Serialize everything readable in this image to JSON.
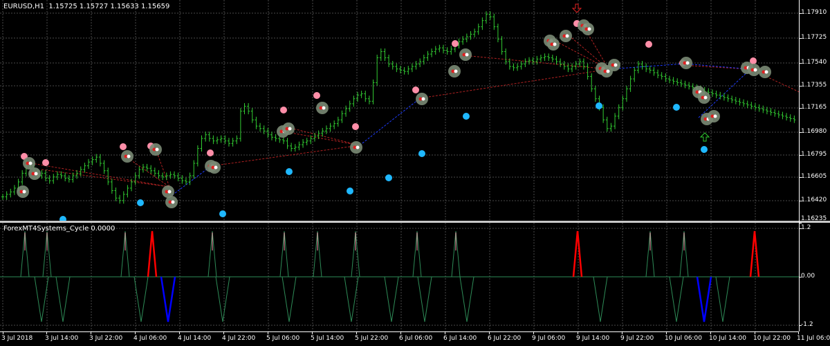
{
  "header": {
    "symbol_tf": "EURUSD,H1",
    "ohlc": "1.15725 1.15727 1.15633 1.15659"
  },
  "indicator": {
    "title": "ForexMT4Systems_Cycle 0.0000",
    "levels": [
      "1.2",
      "0.00",
      "-1.2"
    ]
  },
  "price_axis": {
    "labels": [
      "1.17910",
      "1.17725",
      "1.17540",
      "1.17355",
      "1.17165",
      "1.16980",
      "1.16795",
      "1.16605",
      "1.16420",
      "1.16235"
    ],
    "values": [
      1.1791,
      1.17725,
      1.1754,
      1.17355,
      1.17165,
      1.1698,
      1.16795,
      1.16605,
      1.1642,
      1.16235
    ],
    "range": [
      1.16215,
      1.1801
    ]
  },
  "time_axis": {
    "labels": [
      "3 Jul 2018",
      "3 Jul 14:00",
      "3 Jul 22:00",
      "4 Jul 06:00",
      "4 Jul 14:00",
      "4 Jul 22:00",
      "5 Jul 06:00",
      "5 Jul 14:00",
      "5 Jul 22:00",
      "6 Jul 06:00",
      "6 Jul 14:00",
      "6 Jul 22:00",
      "9 Jul 06:00",
      "9 Jul 14:00",
      "9 Jul 22:00",
      "10 Jul 06:00",
      "10 Jul 14:00",
      "10 Jul 22:00",
      "11 Jul 06:00"
    ]
  },
  "colors": {
    "background": "#000000",
    "grid": "#4a4a4a",
    "bars": "#32cd32",
    "sell_marker": "#ff8ea8",
    "buy_marker": "#1fb8ff",
    "cycle_line": "#2e8b57",
    "cycle_up_extreme": "#ff0000",
    "cycle_down_extreme": "#0000ff",
    "trade_sell_line": "#b22222",
    "trade_buy_line": "#1e3cff"
  },
  "chart_data": {
    "type": "line",
    "title": "EURUSD,H1",
    "xlabel": "",
    "ylabel": "",
    "ylim": [
      1.16215,
      1.1801
    ],
    "series": [
      {
        "values": [
          1.1643,
          1.1645,
          1.1647,
          1.165,
          1.1655,
          1.1662,
          1.167,
          1.1668,
          1.1663,
          1.166,
          1.1662,
          1.1658,
          1.1656,
          1.1659,
          1.1661,
          1.166,
          1.1658,
          1.1657,
          1.166,
          1.1662,
          1.1665,
          1.1668,
          1.1671,
          1.1673,
          1.1675,
          1.167,
          1.1664,
          1.1655,
          1.1648,
          1.1642,
          1.164,
          1.1645,
          1.165,
          1.1655,
          1.166,
          1.1665,
          1.1667,
          1.1666,
          1.1664,
          1.1662,
          1.166,
          1.1659,
          1.166,
          1.1661,
          1.166,
          1.1658,
          1.1656,
          1.1655,
          1.166,
          1.167,
          1.1682,
          1.169,
          1.1693,
          1.169,
          1.1688,
          1.1689,
          1.169,
          1.1688,
          1.1686,
          1.1688,
          1.169,
          1.1712,
          1.1716,
          1.1712,
          1.1705,
          1.17,
          1.1698,
          1.1696,
          1.1693,
          1.1691,
          1.169,
          1.1689,
          1.1688,
          1.1684,
          1.1682,
          1.1683,
          1.1685,
          1.1687,
          1.1688,
          1.169,
          1.1692,
          1.1694,
          1.1696,
          1.1698,
          1.17,
          1.1702,
          1.1705,
          1.171,
          1.1714,
          1.1718,
          1.1722,
          1.1725,
          1.1726,
          1.1722,
          1.172,
          1.1735,
          1.1755,
          1.176,
          1.1755,
          1.175,
          1.1748,
          1.1746,
          1.1745,
          1.1744,
          1.1746,
          1.1748,
          1.175,
          1.1752,
          1.1755,
          1.1758,
          1.176,
          1.1762,
          1.1763,
          1.1761,
          1.176,
          1.1762,
          1.1765,
          1.1768,
          1.177,
          1.1772,
          1.1774,
          1.1776,
          1.178,
          1.1785,
          1.179,
          1.1788,
          1.178,
          1.177,
          1.176,
          1.1752,
          1.1748,
          1.1747,
          1.1748,
          1.175,
          1.1752,
          1.1753,
          1.1752,
          1.1754,
          1.1755,
          1.1756,
          1.1755,
          1.1754,
          1.1752,
          1.175,
          1.1748,
          1.1746,
          1.1748,
          1.175,
          1.1752,
          1.1748,
          1.174,
          1.173,
          1.1722,
          1.1715,
          1.1705,
          1.1698,
          1.17,
          1.1708,
          1.1715,
          1.1722,
          1.173,
          1.1738,
          1.1745,
          1.175,
          1.1748,
          1.1746,
          1.1745,
          1.1743,
          1.1741,
          1.174,
          1.1738,
          1.1737,
          1.1736,
          1.1735,
          1.1734,
          1.1733,
          1.1732,
          1.1731,
          1.173,
          1.1729,
          1.1728,
          1.1727,
          1.1726,
          1.1725,
          1.1724,
          1.1723,
          1.1722,
          1.1721,
          1.172,
          1.1719,
          1.1718,
          1.1717,
          1.1716,
          1.1715,
          1.1714,
          1.1713,
          1.1712,
          1.1711,
          1.171,
          1.1709,
          1.1708,
          1.1707,
          1.1706,
          1.1705
        ]
      }
    ]
  }
}
